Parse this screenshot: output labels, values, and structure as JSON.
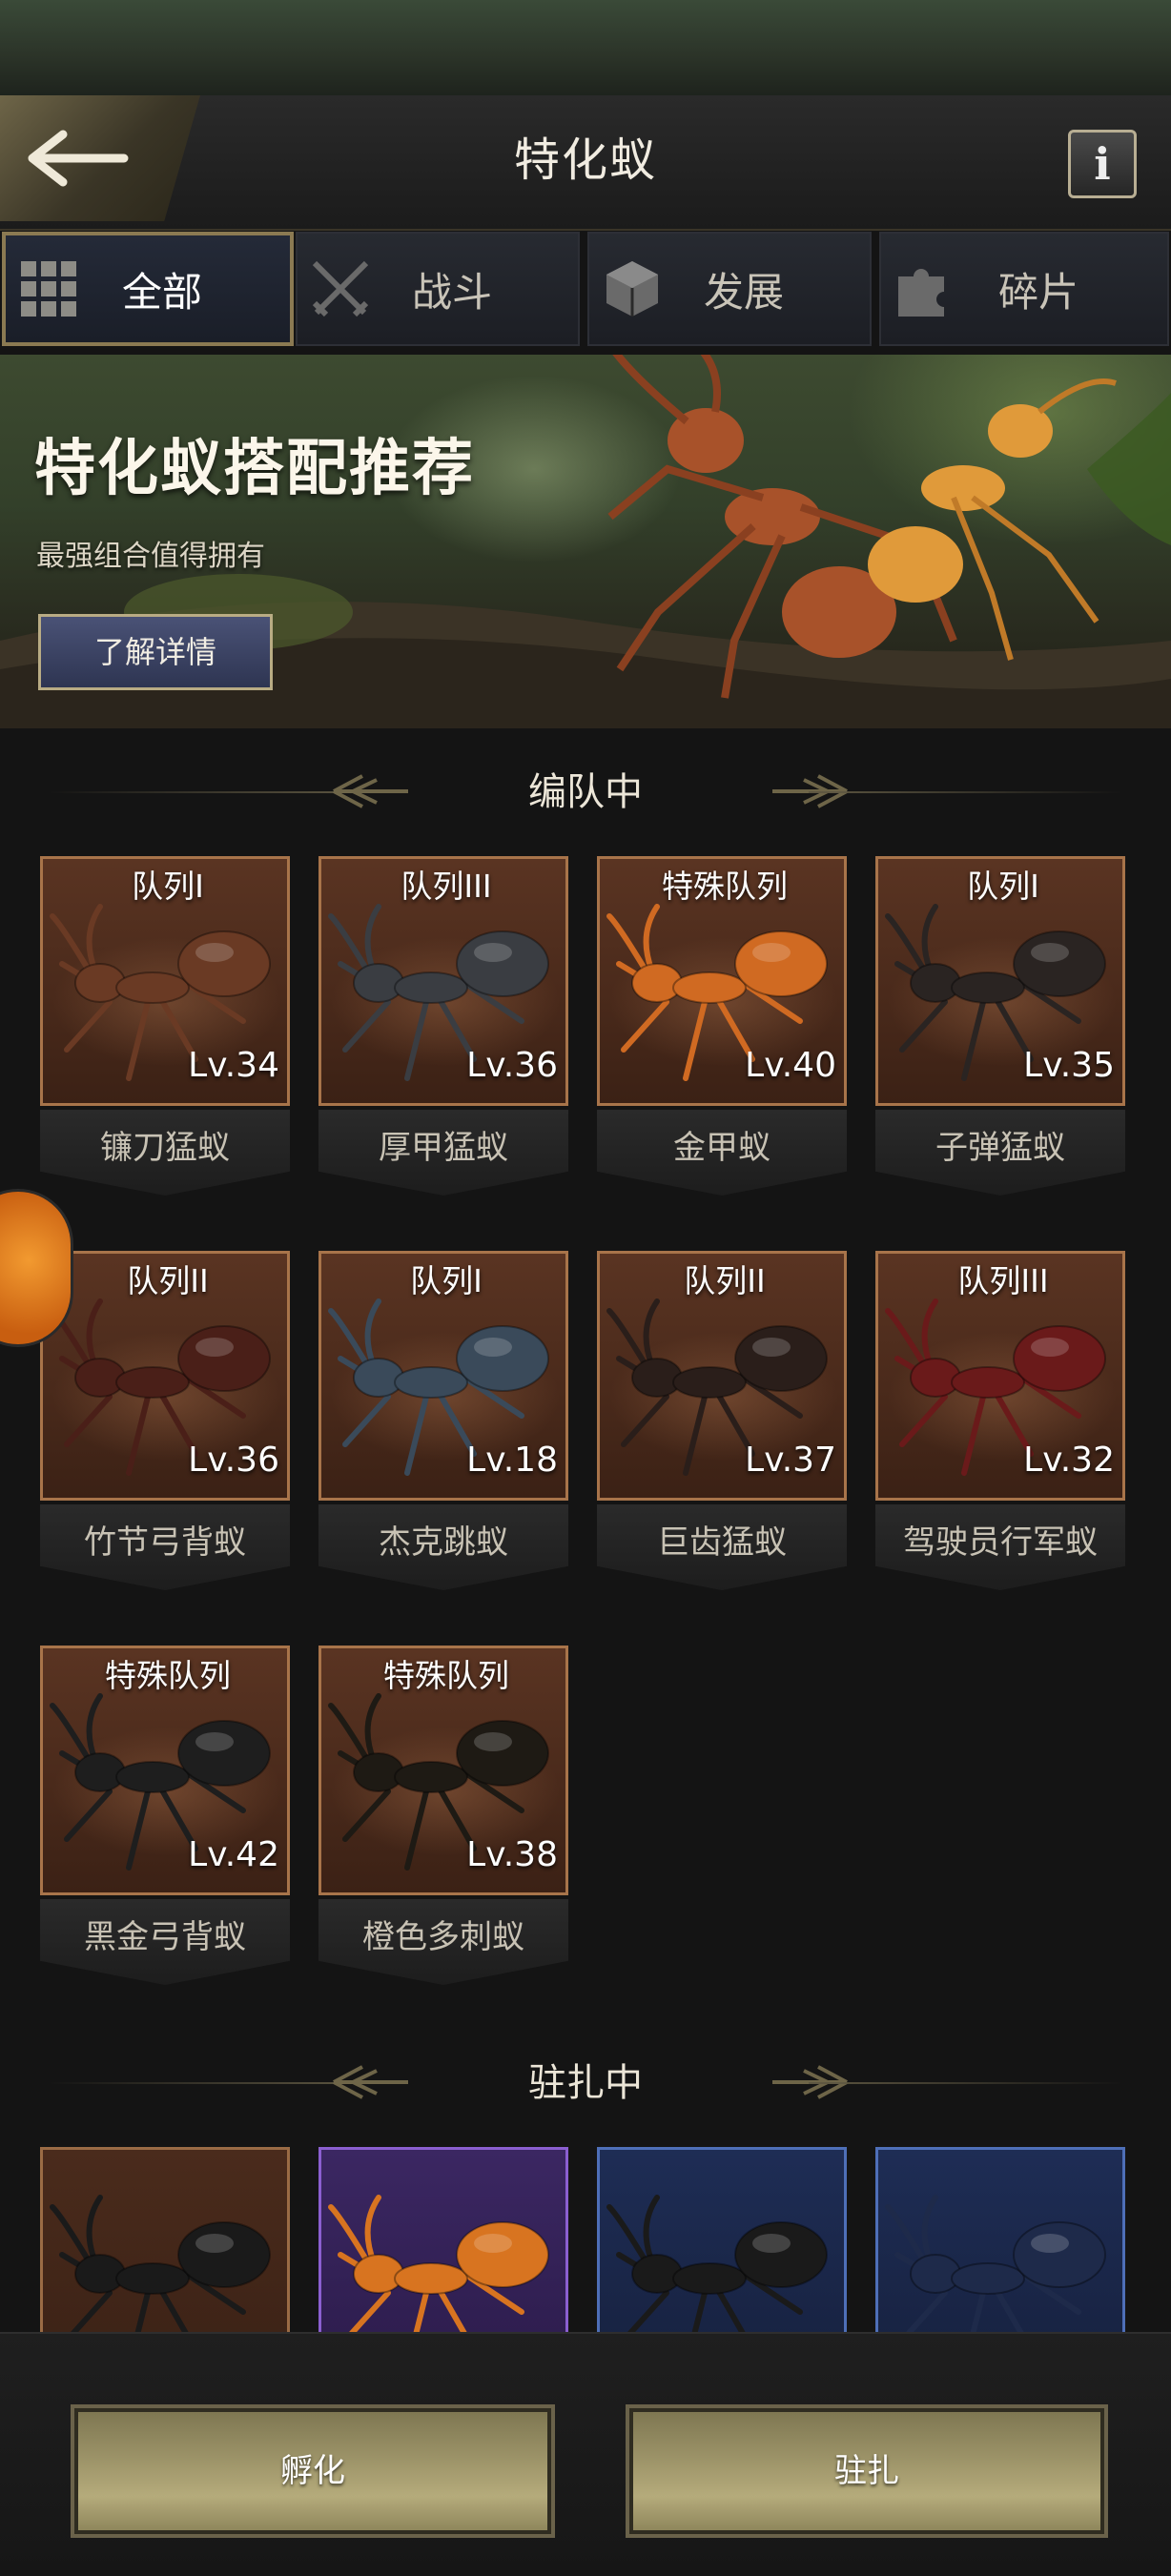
{
  "header": {
    "title": "特化蚁",
    "info_label": "i"
  },
  "tabs": [
    {
      "label": "全部",
      "icon": "grid-icon",
      "active": true
    },
    {
      "label": "战斗",
      "icon": "crossed-swords-icon",
      "active": false
    },
    {
      "label": "发展",
      "icon": "cube-icon",
      "active": false
    },
    {
      "label": "碎片",
      "icon": "puzzle-icon",
      "active": false
    }
  ],
  "banner": {
    "title": "特化蚁搭配推荐",
    "subtitle": "最强组合值得拥有",
    "button_label": "了解详情"
  },
  "sections": {
    "in_team": "编队中",
    "stationed": "驻扎中"
  },
  "in_team_cards": [
    {
      "team": "队列I",
      "level": "Lv.34",
      "name": "镰刀猛蚁",
      "ant_color": "#6a3a24"
    },
    {
      "team": "队列III",
      "level": "Lv.36",
      "name": "厚甲猛蚁",
      "ant_color": "#3a3d42"
    },
    {
      "team": "特殊队列",
      "level": "Lv.40",
      "name": "金甲蚁",
      "ant_color": "#d06a22"
    },
    {
      "team": "队列I",
      "level": "Lv.35",
      "name": "子弹猛蚁",
      "ant_color": "#2a2422"
    },
    {
      "team": "队列II",
      "level": "Lv.36",
      "name": "竹节弓背蚁",
      "ant_color": "#4a1f18"
    },
    {
      "team": "队列I",
      "level": "Lv.18",
      "name": "杰克跳蚁",
      "ant_color": "#3a4a5a"
    },
    {
      "team": "队列II",
      "level": "Lv.37",
      "name": "巨齿猛蚁",
      "ant_color": "#2a1e1a"
    },
    {
      "team": "队列III",
      "level": "Lv.32",
      "name": "驾驶员行军蚁",
      "ant_color": "#6a1a1a"
    },
    {
      "team": "特殊队列",
      "level": "Lv.42",
      "name": "黑金弓背蚁",
      "ant_color": "#1e1e1e"
    },
    {
      "team": "特殊队列",
      "level": "Lv.38",
      "name": "橙色多刺蚁",
      "ant_color": "#1e1a14"
    }
  ],
  "stationed_cards": [
    {
      "frame": "brown-dark",
      "ant_color": "#1a1a1a"
    },
    {
      "frame": "purple",
      "ant_color": "#d87420"
    },
    {
      "frame": "blue",
      "ant_color": "#1a1a1a"
    },
    {
      "frame": "blue",
      "ant_color": "#1e2a4a"
    }
  ],
  "bottom": {
    "hatch_label": "孵化",
    "station_label": "驻扎"
  },
  "colors": {
    "frame_gold": "#8b7a52",
    "card_border": "#a8744a",
    "accent_button": "#b5ab7b"
  }
}
